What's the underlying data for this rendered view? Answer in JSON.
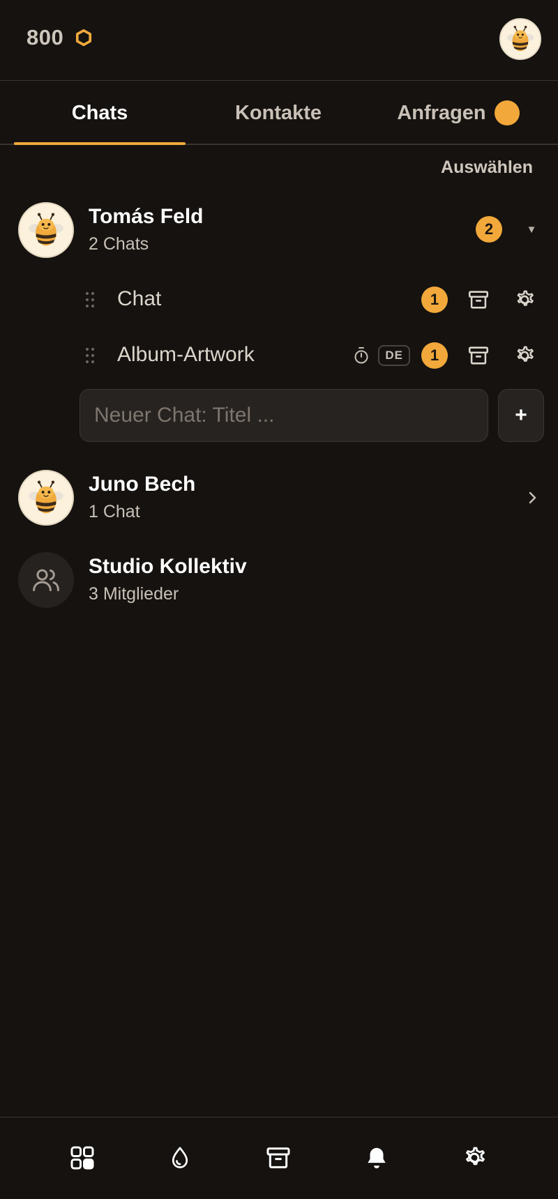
{
  "header": {
    "credits": "800",
    "credits_icon": "hexagon-coin-icon",
    "profile_icon": "bee-avatar-icon"
  },
  "tabs": [
    {
      "label": "Chats",
      "active": true
    },
    {
      "label": "Kontakte",
      "active": false
    },
    {
      "label": "Anfragen",
      "active": false,
      "indicator": true
    }
  ],
  "select_label": "Auswählen",
  "contacts": [
    {
      "name": "Tomás Feld",
      "subtitle": "2 Chats",
      "badge": "2",
      "expanded": true,
      "chats": [
        {
          "title": "Chat",
          "badge": "1"
        },
        {
          "title": "Album-Artwork",
          "badge": "1",
          "timer": true,
          "language": "DE"
        }
      ]
    },
    {
      "name": "Juno Bech",
      "subtitle": "1 Chat"
    },
    {
      "name": "Studio Kollektiv",
      "subtitle": "3 Mitglieder",
      "group": true
    }
  ],
  "new_chat": {
    "placeholder": "Neuer Chat: Titel ...",
    "add_label": "+"
  },
  "bottom_nav": [
    "grid-icon",
    "drop-icon",
    "archive-icon",
    "bell-icon",
    "settings-icon"
  ],
  "colors": {
    "accent": "#f2a83a",
    "background": "#151210",
    "surface": "#272320"
  }
}
